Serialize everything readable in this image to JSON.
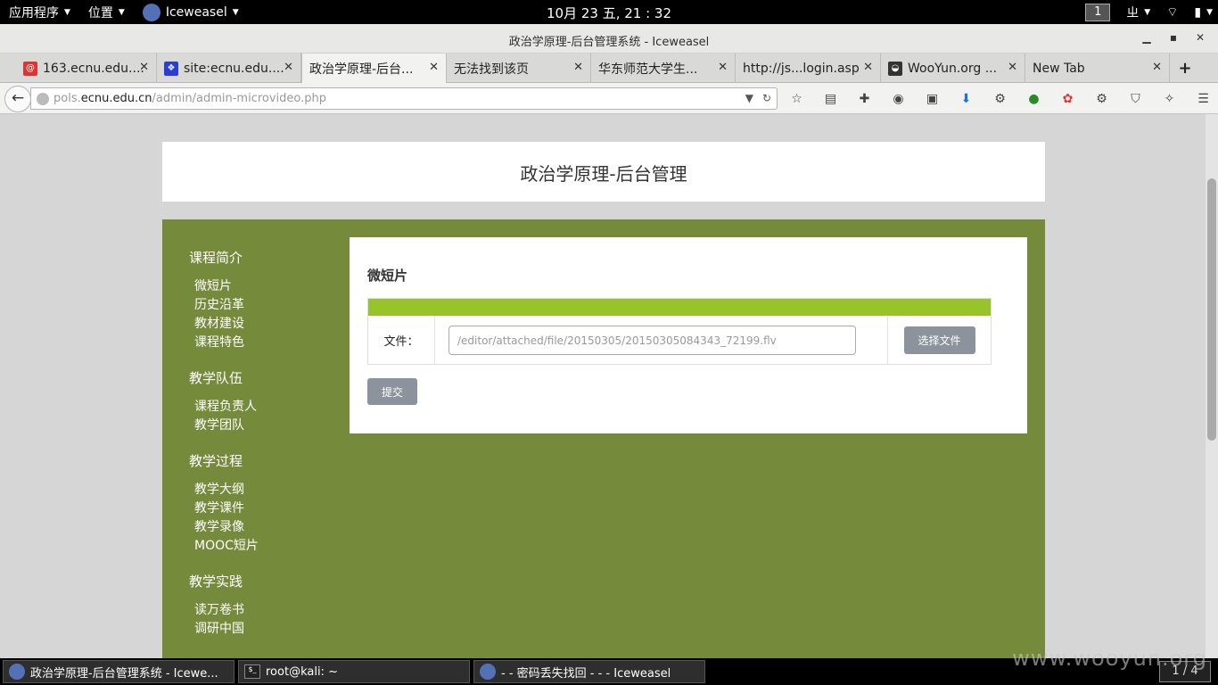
{
  "topbar": {
    "apps_label": "应用程序",
    "places_label": "位置",
    "browser_label": "Iceweasel",
    "clock": "10月 23 五, 21 : 32",
    "workspace": "1",
    "input_method": "ㄓ"
  },
  "window": {
    "title": "政治学原理-后台管理系统 - Iceweasel"
  },
  "tabs": [
    {
      "label": "163.ecnu.edu...."
    },
    {
      "label": "site:ecnu.edu...."
    },
    {
      "label": "政治学原理-后台..."
    },
    {
      "label": "无法找到该页"
    },
    {
      "label": "华东师范大学生..."
    },
    {
      "label": "http://js...login.asp"
    },
    {
      "label": "WooYun.org ..."
    },
    {
      "label": "New Tab"
    }
  ],
  "urlbar": {
    "prefix": "pols.",
    "domain": "ecnu.edu.cn",
    "path": "/admin/admin-microvideo.php"
  },
  "page": {
    "header_title": "政治学原理-后台管理",
    "sidebar": [
      {
        "title": "课程简介",
        "items": [
          "微短片",
          "历史沿革",
          "教材建设",
          "课程特色"
        ]
      },
      {
        "title": "教学队伍",
        "items": [
          "课程负责人",
          "教学团队"
        ]
      },
      {
        "title": "教学过程",
        "items": [
          "教学大纲",
          "教学课件",
          "教学录像",
          "MOOC短片"
        ]
      },
      {
        "title": "教学实践",
        "items": [
          "读万卷书",
          "调研中国"
        ]
      }
    ],
    "card_title": "微短片",
    "file_label": "文件：",
    "file_value": "/editor/attached/file/20150305/20150305084343_72199.flv",
    "choose_file": "选择文件",
    "submit": "提交"
  },
  "taskbar": {
    "tasks": [
      {
        "label": "政治学原理-后台管理系统 - Icewe..."
      },
      {
        "label": "root@kali: ~"
      },
      {
        "label": "- - 密码丢失找回 - - - Iceweasel"
      }
    ],
    "pager": "1 / 4"
  },
  "watermark": "www.wooyun.org",
  "colors": {
    "accent": "#98c42a",
    "panel": "#768a3c",
    "button": "#8c939c"
  }
}
